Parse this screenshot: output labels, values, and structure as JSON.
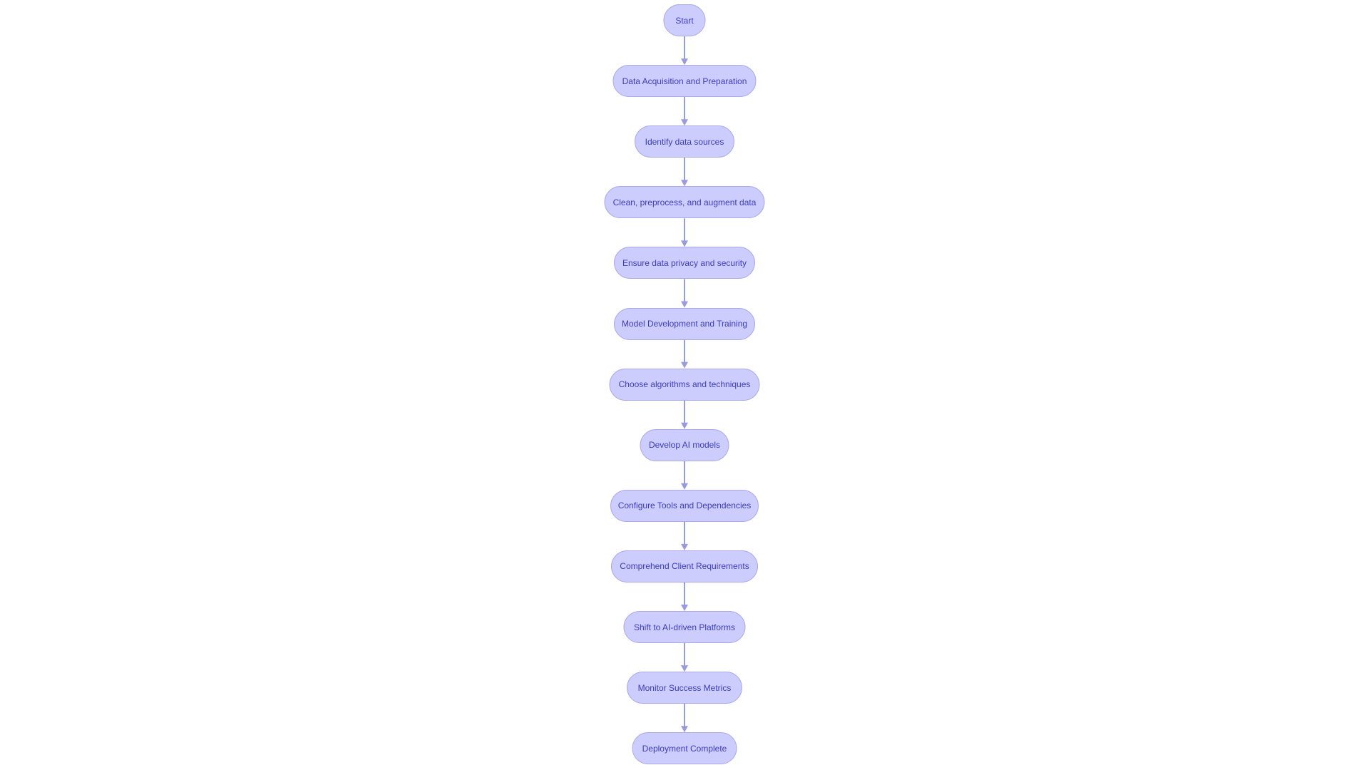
{
  "flowchart": {
    "nodes": [
      {
        "label": "Start"
      },
      {
        "label": "Data Acquisition and Preparation"
      },
      {
        "label": "Identify data sources"
      },
      {
        "label": "Clean, preprocess, and augment data"
      },
      {
        "label": "Ensure data privacy and security"
      },
      {
        "label": "Model Development and Training"
      },
      {
        "label": "Choose algorithms and techniques"
      },
      {
        "label": "Develop AI models"
      },
      {
        "label": "Configure Tools and Dependencies"
      },
      {
        "label": "Comprehend Client Requirements"
      },
      {
        "label": "Shift to AI-driven Platforms"
      },
      {
        "label": "Monitor Success Metrics"
      },
      {
        "label": "Deployment Complete"
      }
    ],
    "colors": {
      "node_fill": "#cdcdfd",
      "node_stroke": "#a9a9ec",
      "text": "#3b3bc4",
      "edge": "#9a9ae0"
    }
  }
}
